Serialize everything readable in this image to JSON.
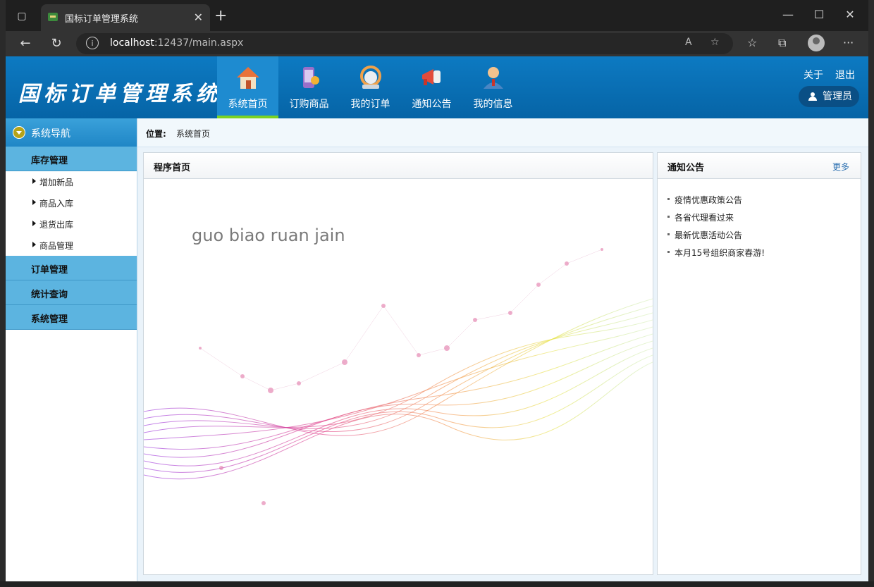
{
  "browser": {
    "tab_title": "国标订单管理系统",
    "tab_close": "✕",
    "new_tab": "+",
    "url_host": "localhost",
    "url_rest": ":12437/main.aspx",
    "window_controls": {
      "minimize": "—",
      "maximize": "☐",
      "close": "✕"
    }
  },
  "header": {
    "logo": "国标订单管理系统",
    "nav": [
      {
        "label": "系统首页",
        "icon": "home-icon",
        "color": "#e8733a"
      },
      {
        "label": "订购商品",
        "icon": "phone-shop-icon",
        "color": "#9a6fc9"
      },
      {
        "label": "我的订单",
        "icon": "support-icon",
        "color": "#f1a24a"
      },
      {
        "label": "通知公告",
        "icon": "megaphone-icon",
        "color": "#e24b3b"
      },
      {
        "label": "我的信息",
        "icon": "user-profile-icon",
        "color": "#4a86c4"
      }
    ],
    "about": "关于",
    "logout": "退出",
    "user": "管理员"
  },
  "sidebar": {
    "title": "系统导航",
    "groups": [
      {
        "label": "库存管理",
        "items": [
          "增加新品",
          "商品入库",
          "退货出库",
          "商品管理"
        ]
      },
      {
        "label": "订单管理"
      },
      {
        "label": "统计查询"
      },
      {
        "label": "系统管理"
      }
    ]
  },
  "breadcrumb": {
    "label": "位置:",
    "value": "系统首页"
  },
  "main_panel": {
    "title": "程序首页",
    "art_text": "guo biao ruan jain"
  },
  "notice_panel": {
    "title": "通知公告",
    "more": "更多",
    "items": [
      "疫情优惠政策公告",
      "各省代理看过来",
      "最新优惠活动公告",
      "本月15号组织商家春游!"
    ]
  },
  "colors": {
    "header": "#0d7ac2",
    "sidebar_group": "#5cb4e0",
    "active_underline": "#7ad322"
  }
}
